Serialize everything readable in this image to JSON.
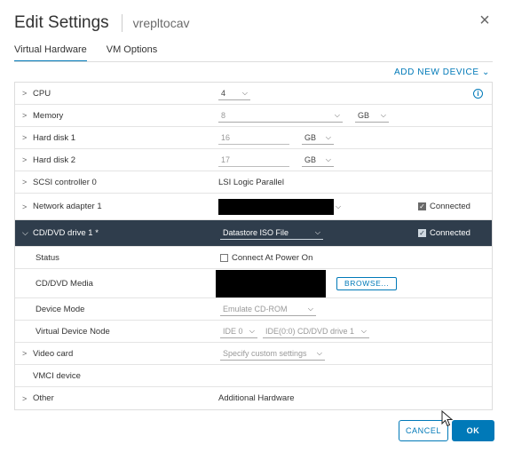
{
  "dialog": {
    "title": "Edit Settings",
    "vm_name": "vrepltocav",
    "close_glyph": "×"
  },
  "tabs": [
    {
      "label": "Virtual Hardware",
      "active": true
    },
    {
      "label": "VM Options",
      "active": false
    }
  ],
  "add_device_label": "ADD NEW DEVICE ⌄",
  "hardware": {
    "cpu": {
      "label": "CPU",
      "value": "4"
    },
    "memory": {
      "label": "Memory",
      "value": "8",
      "unit": "GB"
    },
    "hard_disk_1": {
      "label": "Hard disk 1",
      "value": "16",
      "unit": "GB"
    },
    "hard_disk_2": {
      "label": "Hard disk 2",
      "value": "17",
      "unit": "GB"
    },
    "scsi": {
      "label": "SCSI controller 0",
      "value": "LSI Logic Parallel"
    },
    "network": {
      "label": "Network adapter 1",
      "connected_label": "Connected",
      "connected": true
    },
    "cddvd": {
      "label": "CD/DVD drive 1 *",
      "value": "Datastore ISO File",
      "connected_label": "Connected",
      "connected": true
    },
    "status": {
      "label": "Status",
      "checkbox_label": "Connect At Power On",
      "checked": false
    },
    "media": {
      "label": "CD/DVD Media",
      "browse_label": "BROWSE..."
    },
    "device_mode": {
      "label": "Device Mode",
      "value": "Emulate CD-ROM"
    },
    "device_node": {
      "label": "Virtual Device Node",
      "bus": "IDE 0",
      "node": "IDE(0:0) CD/DVD drive 1"
    },
    "video": {
      "label": "Video card",
      "value": "Specify custom settings"
    },
    "vmci": {
      "label": "VMCI device"
    },
    "other": {
      "label": "Other",
      "value": "Additional Hardware"
    }
  },
  "footer": {
    "cancel_label": "CANCEL",
    "ok_label": "OK"
  },
  "colors": {
    "accent": "#0079b8",
    "selected_row": "#2f3d4c"
  },
  "icons": {
    "close": "close-icon",
    "info": "info-icon",
    "caret_right": "chevron-right-icon",
    "caret_down": "chevron-down-icon"
  }
}
